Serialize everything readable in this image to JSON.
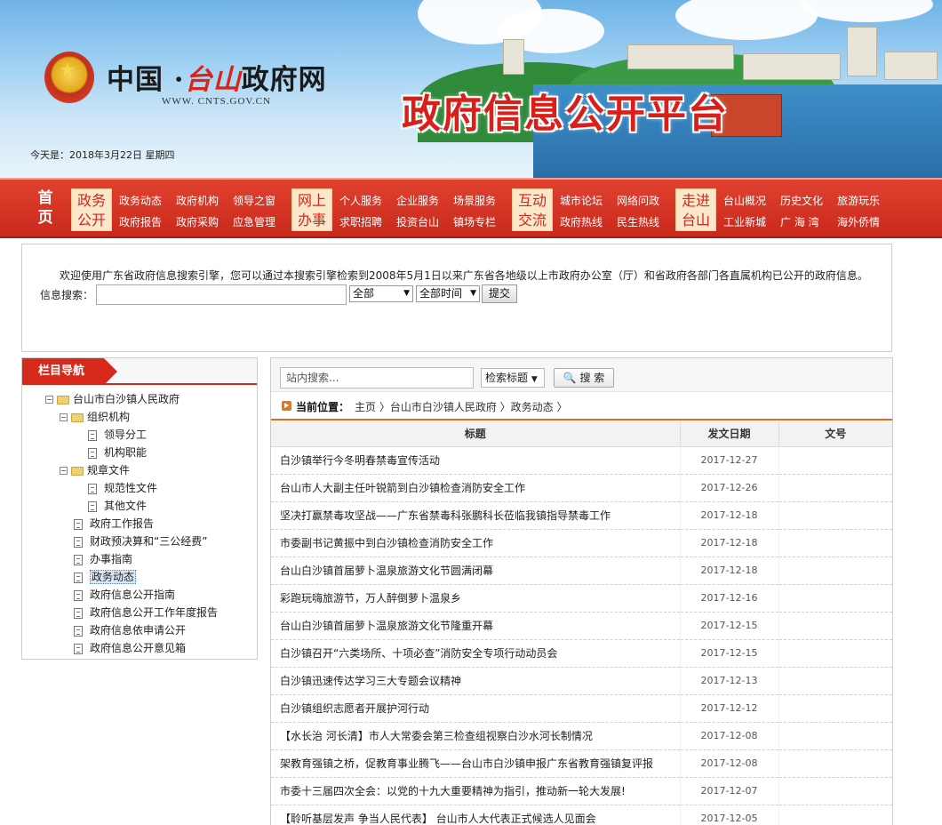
{
  "header": {
    "site_title_a": "中国 ·",
    "site_title_b": "台山",
    "site_title_c": "政府网",
    "site_url": "WWW. CNTS.GOV.CN",
    "platform_title": "政府信息公开平台",
    "today": "今天是：2018年3月22日  星期四"
  },
  "nav": {
    "home": [
      "首",
      "页"
    ],
    "groups": [
      {
        "tag": [
          "政务",
          "公开"
        ],
        "links": [
          [
            "政务动态",
            "政府机构",
            "领导之窗"
          ],
          [
            "政府报告",
            "政府采购",
            "应急管理"
          ]
        ]
      },
      {
        "tag": [
          "网上",
          "办事"
        ],
        "links": [
          [
            "个人服务",
            "企业服务",
            "场景服务"
          ],
          [
            "求职招聘",
            "投资台山",
            "镇场专栏"
          ]
        ]
      },
      {
        "tag": [
          "互动",
          "交流"
        ],
        "links": [
          [
            "城市论坛",
            "网络问政"
          ],
          [
            "政府热线",
            "民生热线"
          ]
        ]
      },
      {
        "tag": [
          "走进",
          "台山"
        ],
        "links": [
          [
            "台山概况",
            "历史文化",
            "旅游玩乐"
          ],
          [
            "工业新城",
            "广 海 湾",
            "海外侨情"
          ]
        ]
      }
    ]
  },
  "gov_search": {
    "intro": "欢迎使用广东省政府信息搜索引擎，您可以通过本搜索引擎检索到2008年5月1日以来广东省各地级以上市政府办公室（厅）和省政府各部门各直属机构已公开的政府信息。",
    "label": "信息搜索：",
    "query": "",
    "scope": "全部",
    "time": "全部时间",
    "submit": "提交"
  },
  "sidebar": {
    "title": "栏目导航",
    "tree": {
      "root": "台山市白沙镇人民政府",
      "org": "组织机构",
      "org_items": [
        "领导分工",
        "机构职能"
      ],
      "rules": "规章文件",
      "rules_items": [
        "规范性文件",
        "其他文件"
      ],
      "items": [
        "政府工作报告",
        "财政预决算和“三公经费”",
        "办事指南",
        "政务动态",
        "政府信息公开指南",
        "政府信息公开工作年度报告",
        "政府信息依申请公开",
        "政府信息公开意见箱"
      ],
      "active": "政务动态"
    }
  },
  "main": {
    "search_placeholder": "站内搜索...",
    "search_field": "检索标题",
    "search_button": "搜 索",
    "crumb_label": "当前位置：",
    "crumb": "主页 〉台山市白沙镇人民政府 〉政务动态 〉",
    "columns": [
      "标题",
      "发文日期",
      "文号"
    ],
    "rows": [
      {
        "title": "白沙镇举行今冬明春禁毒宣传活动",
        "date": "2017-12-27",
        "doc_no": ""
      },
      {
        "title": "台山市人大副主任叶锐箭到白沙镇检查消防安全工作",
        "date": "2017-12-26",
        "doc_no": ""
      },
      {
        "title": "坚决打赢禁毒攻坚战——广东省禁毒科张鹏科长莅临我镇指导禁毒工作",
        "date": "2017-12-18",
        "doc_no": ""
      },
      {
        "title": "市委副书记黄振中到白沙镇检查消防安全工作",
        "date": "2017-12-18",
        "doc_no": ""
      },
      {
        "title": "台山白沙镇首届萝卜温泉旅游文化节圆满闭幕",
        "date": "2017-12-18",
        "doc_no": ""
      },
      {
        "title": "彩跑玩嗨旅游节，万人醉倒萝卜温泉乡",
        "date": "2017-12-16",
        "doc_no": ""
      },
      {
        "title": "台山白沙镇首届萝卜温泉旅游文化节隆重开幕",
        "date": "2017-12-15",
        "doc_no": ""
      },
      {
        "title": "白沙镇召开“六类场所、十项必查”消防安全专项行动动员会",
        "date": "2017-12-15",
        "doc_no": ""
      },
      {
        "title": "白沙镇迅速传达学习三大专题会议精神",
        "date": "2017-12-13",
        "doc_no": ""
      },
      {
        "title": "白沙镇组织志愿者开展护河行动",
        "date": "2017-12-12",
        "doc_no": ""
      },
      {
        "title": "【水长治 河长清】市人大常委会第三检查组视察白沙水河长制情况",
        "date": "2017-12-08",
        "doc_no": ""
      },
      {
        "title": "架教育强镇之桥，促教育事业腾飞——台山市白沙镇申报广东省教育强镇复评报",
        "date": "2017-12-08",
        "doc_no": ""
      },
      {
        "title": "市委十三届四次全会：以党的十九大重要精神为指引，推动新一轮大发展!",
        "date": "2017-12-07",
        "doc_no": ""
      },
      {
        "title": "【聆听基层发声 争当人民代表】 台山市人大代表正式候选人见面会",
        "date": "2017-12-05",
        "doc_no": ""
      }
    ]
  },
  "colors": {
    "nav_red": "#d7291b",
    "accent_orange": "#e2691a",
    "title_red": "#d91f1a"
  }
}
